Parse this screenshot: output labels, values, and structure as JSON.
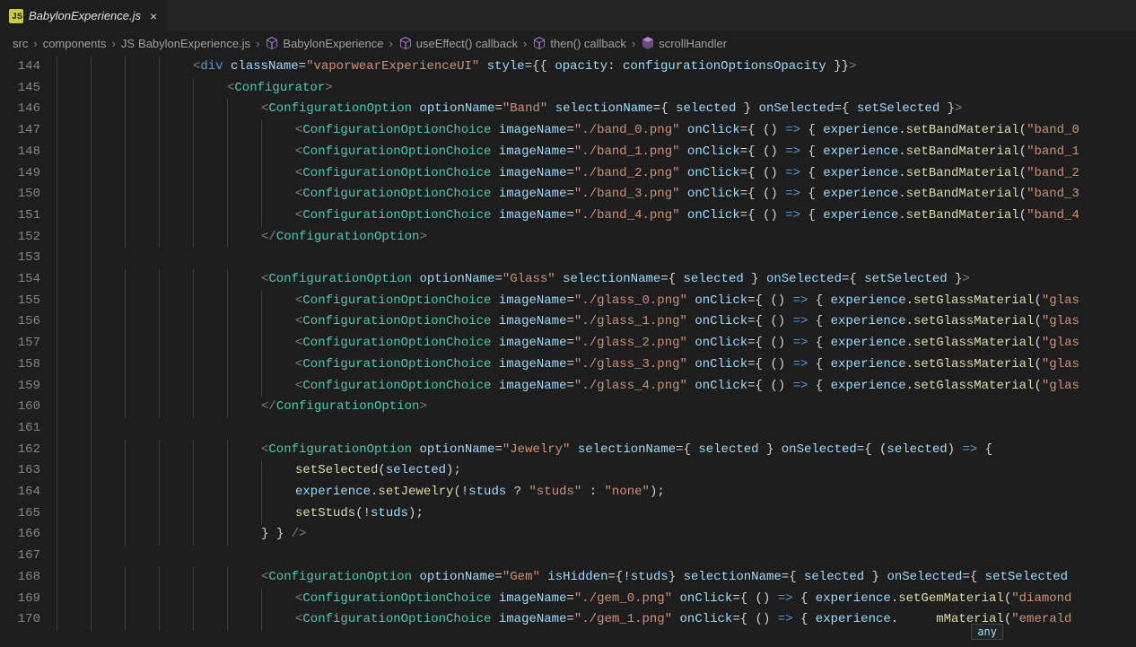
{
  "tab": {
    "filename": "BabylonExperience.js",
    "iconText": "JS"
  },
  "breadcrumb": {
    "items": [
      {
        "label": "src"
      },
      {
        "label": "components"
      },
      {
        "label": "BabylonExperience.js",
        "icon": "js"
      },
      {
        "label": "BabylonExperience",
        "icon": "cube"
      },
      {
        "label": "useEffect() callback",
        "icon": "cube"
      },
      {
        "label": "then() callback",
        "icon": "cube"
      },
      {
        "label": "scrollHandler",
        "icon": "method"
      }
    ]
  },
  "lineStart": 144,
  "lineEnd": 170,
  "hoverTip": "any",
  "lines": [
    {
      "n": 144,
      "indent": 4,
      "html": "<span class='tok-punc'>&lt;</span><span class='tok-kw'>div</span> <span class='tok-attr'>className</span><span class='tok-op'>=</span><span class='tok-str'>\"vaporwearExperienceUI\"</span> <span class='tok-attr'>style</span><span class='tok-op'>=</span><span class='tok-brace'>{{</span> <span class='tok-attr'>opacity</span><span class='tok-op'>:</span> <span class='tok-var'>configurationOptionsOpacity</span> <span class='tok-brace'>}}</span><span class='tok-punc'>&gt;</span>"
    },
    {
      "n": 145,
      "indent": 5,
      "html": "<span class='tok-punc'>&lt;</span><span class='tok-tag'>Configurator</span><span class='tok-punc'>&gt;</span>"
    },
    {
      "n": 146,
      "indent": 6,
      "html": "<span class='tok-punc'>&lt;</span><span class='tok-tag'>ConfigurationOption</span> <span class='tok-attr'>optionName</span><span class='tok-op'>=</span><span class='tok-str'>\"Band\"</span> <span class='tok-attr'>selectionName</span><span class='tok-op'>=</span><span class='tok-brace'>{</span> <span class='tok-var'>selected</span> <span class='tok-brace'>}</span> <span class='tok-attr'>onSelected</span><span class='tok-op'>=</span><span class='tok-brace'>{</span> <span class='tok-var'>setSelected</span> <span class='tok-brace'>}</span><span class='tok-punc'>&gt;</span>"
    },
    {
      "n": 147,
      "indent": 7,
      "html": "<span class='tok-punc'>&lt;</span><span class='tok-tag'>ConfigurationOptionChoice</span> <span class='tok-attr'>imageName</span><span class='tok-op'>=</span><span class='tok-str'>\"./band_0.png\"</span> <span class='tok-attr'>onClick</span><span class='tok-op'>=</span><span class='tok-brace'>{</span> <span class='tok-op'>()</span> <span class='tok-kw'>=&gt;</span> <span class='tok-brace'>{</span> <span class='tok-var'>experience</span><span class='tok-op'>.</span><span class='tok-fn'>setBandMaterial</span><span class='tok-op'>(</span><span class='tok-str'>\"band_0</span>"
    },
    {
      "n": 148,
      "indent": 7,
      "html": "<span class='tok-punc'>&lt;</span><span class='tok-tag'>ConfigurationOptionChoice</span> <span class='tok-attr'>imageName</span><span class='tok-op'>=</span><span class='tok-str'>\"./band_1.png\"</span> <span class='tok-attr'>onClick</span><span class='tok-op'>=</span><span class='tok-brace'>{</span> <span class='tok-op'>()</span> <span class='tok-kw'>=&gt;</span> <span class='tok-brace'>{</span> <span class='tok-var'>experience</span><span class='tok-op'>.</span><span class='tok-fn'>setBandMaterial</span><span class='tok-op'>(</span><span class='tok-str'>\"band_1</span>"
    },
    {
      "n": 149,
      "indent": 7,
      "html": "<span class='tok-punc'>&lt;</span><span class='tok-tag'>ConfigurationOptionChoice</span> <span class='tok-attr'>imageName</span><span class='tok-op'>=</span><span class='tok-str'>\"./band_2.png\"</span> <span class='tok-attr'>onClick</span><span class='tok-op'>=</span><span class='tok-brace'>{</span> <span class='tok-op'>()</span> <span class='tok-kw'>=&gt;</span> <span class='tok-brace'>{</span> <span class='tok-var'>experience</span><span class='tok-op'>.</span><span class='tok-fn'>setBandMaterial</span><span class='tok-op'>(</span><span class='tok-str'>\"band_2</span>"
    },
    {
      "n": 150,
      "indent": 7,
      "html": "<span class='tok-punc'>&lt;</span><span class='tok-tag'>ConfigurationOptionChoice</span> <span class='tok-attr'>imageName</span><span class='tok-op'>=</span><span class='tok-str'>\"./band_3.png\"</span> <span class='tok-attr'>onClick</span><span class='tok-op'>=</span><span class='tok-brace'>{</span> <span class='tok-op'>()</span> <span class='tok-kw'>=&gt;</span> <span class='tok-brace'>{</span> <span class='tok-var'>experience</span><span class='tok-op'>.</span><span class='tok-fn'>setBandMaterial</span><span class='tok-op'>(</span><span class='tok-str'>\"band_3</span>"
    },
    {
      "n": 151,
      "indent": 7,
      "html": "<span class='tok-punc'>&lt;</span><span class='tok-tag'>ConfigurationOptionChoice</span> <span class='tok-attr'>imageName</span><span class='tok-op'>=</span><span class='tok-str'>\"./band_4.png\"</span> <span class='tok-attr'>onClick</span><span class='tok-op'>=</span><span class='tok-brace'>{</span> <span class='tok-op'>()</span> <span class='tok-kw'>=&gt;</span> <span class='tok-brace'>{</span> <span class='tok-var'>experience</span><span class='tok-op'>.</span><span class='tok-fn'>setBandMaterial</span><span class='tok-op'>(</span><span class='tok-str'>\"band_4</span>"
    },
    {
      "n": 152,
      "indent": 6,
      "html": "<span class='tok-punc'>&lt;/</span><span class='tok-tag'>ConfigurationOption</span><span class='tok-punc'>&gt;</span>"
    },
    {
      "n": 153,
      "indent": 0,
      "html": ""
    },
    {
      "n": 154,
      "indent": 6,
      "html": "<span class='tok-punc'>&lt;</span><span class='tok-tag'>ConfigurationOption</span> <span class='tok-attr'>optionName</span><span class='tok-op'>=</span><span class='tok-str'>\"Glass\"</span> <span class='tok-attr'>selectionName</span><span class='tok-op'>=</span><span class='tok-brace'>{</span> <span class='tok-var'>selected</span> <span class='tok-brace'>}</span> <span class='tok-attr'>onSelected</span><span class='tok-op'>=</span><span class='tok-brace'>{</span> <span class='tok-var'>setSelected</span> <span class='tok-brace'>}</span><span class='tok-punc'>&gt;</span>"
    },
    {
      "n": 155,
      "indent": 7,
      "html": "<span class='tok-punc'>&lt;</span><span class='tok-tag'>ConfigurationOptionChoice</span> <span class='tok-attr'>imageName</span><span class='tok-op'>=</span><span class='tok-str'>\"./glass_0.png\"</span> <span class='tok-attr'>onClick</span><span class='tok-op'>=</span><span class='tok-brace'>{</span> <span class='tok-op'>()</span> <span class='tok-kw'>=&gt;</span> <span class='tok-brace'>{</span> <span class='tok-var'>experience</span><span class='tok-op'>.</span><span class='tok-fn'>setGlassMaterial</span><span class='tok-op'>(</span><span class='tok-str'>\"glas</span>"
    },
    {
      "n": 156,
      "indent": 7,
      "html": "<span class='tok-punc'>&lt;</span><span class='tok-tag'>ConfigurationOptionChoice</span> <span class='tok-attr'>imageName</span><span class='tok-op'>=</span><span class='tok-str'>\"./glass_1.png\"</span> <span class='tok-attr'>onClick</span><span class='tok-op'>=</span><span class='tok-brace'>{</span> <span class='tok-op'>()</span> <span class='tok-kw'>=&gt;</span> <span class='tok-brace'>{</span> <span class='tok-var'>experience</span><span class='tok-op'>.</span><span class='tok-fn'>setGlassMaterial</span><span class='tok-op'>(</span><span class='tok-str'>\"glas</span>"
    },
    {
      "n": 157,
      "indent": 7,
      "html": "<span class='tok-punc'>&lt;</span><span class='tok-tag'>ConfigurationOptionChoice</span> <span class='tok-attr'>imageName</span><span class='tok-op'>=</span><span class='tok-str'>\"./glass_2.png\"</span> <span class='tok-attr'>onClick</span><span class='tok-op'>=</span><span class='tok-brace'>{</span> <span class='tok-op'>()</span> <span class='tok-kw'>=&gt;</span> <span class='tok-brace'>{</span> <span class='tok-var'>experience</span><span class='tok-op'>.</span><span class='tok-fn'>setGlassMaterial</span><span class='tok-op'>(</span><span class='tok-str'>\"glas</span>"
    },
    {
      "n": 158,
      "indent": 7,
      "html": "<span class='tok-punc'>&lt;</span><span class='tok-tag'>ConfigurationOptionChoice</span> <span class='tok-attr'>imageName</span><span class='tok-op'>=</span><span class='tok-str'>\"./glass_3.png\"</span> <span class='tok-attr'>onClick</span><span class='tok-op'>=</span><span class='tok-brace'>{</span> <span class='tok-op'>()</span> <span class='tok-kw'>=&gt;</span> <span class='tok-brace'>{</span> <span class='tok-var'>experience</span><span class='tok-op'>.</span><span class='tok-fn'>setGlassMaterial</span><span class='tok-op'>(</span><span class='tok-str'>\"glas</span>"
    },
    {
      "n": 159,
      "indent": 7,
      "html": "<span class='tok-punc'>&lt;</span><span class='tok-tag'>ConfigurationOptionChoice</span> <span class='tok-attr'>imageName</span><span class='tok-op'>=</span><span class='tok-str'>\"./glass_4.png\"</span> <span class='tok-attr'>onClick</span><span class='tok-op'>=</span><span class='tok-brace'>{</span> <span class='tok-op'>()</span> <span class='tok-kw'>=&gt;</span> <span class='tok-brace'>{</span> <span class='tok-var'>experience</span><span class='tok-op'>.</span><span class='tok-fn'>setGlassMaterial</span><span class='tok-op'>(</span><span class='tok-str'>\"glas</span>"
    },
    {
      "n": 160,
      "indent": 6,
      "html": "<span class='tok-punc'>&lt;/</span><span class='tok-tag'>ConfigurationOption</span><span class='tok-punc'>&gt;</span>"
    },
    {
      "n": 161,
      "indent": 0,
      "html": ""
    },
    {
      "n": 162,
      "indent": 6,
      "html": "<span class='tok-punc'>&lt;</span><span class='tok-tag'>ConfigurationOption</span> <span class='tok-attr'>optionName</span><span class='tok-op'>=</span><span class='tok-str'>\"Jewelry\"</span> <span class='tok-attr'>selectionName</span><span class='tok-op'>=</span><span class='tok-brace'>{</span> <span class='tok-var'>selected</span> <span class='tok-brace'>}</span> <span class='tok-attr'>onSelected</span><span class='tok-op'>=</span><span class='tok-brace'>{</span> <span class='tok-op'>(</span><span class='tok-var'>selected</span><span class='tok-op'>)</span> <span class='tok-kw'>=&gt;</span> <span class='tok-brace'>{</span>"
    },
    {
      "n": 163,
      "indent": 7,
      "html": "<span class='tok-fn'>setSelected</span><span class='tok-op'>(</span><span class='tok-var'>selected</span><span class='tok-op'>);</span>"
    },
    {
      "n": 164,
      "indent": 7,
      "html": "<span class='tok-var'>experience</span><span class='tok-op'>.</span><span class='tok-fn'>setJewelry</span><span class='tok-op'>(!</span><span class='tok-var'>studs</span> <span class='tok-op'>?</span> <span class='tok-str'>\"studs\"</span> <span class='tok-op'>:</span> <span class='tok-str'>\"none\"</span><span class='tok-op'>);</span>"
    },
    {
      "n": 165,
      "indent": 7,
      "html": "<span class='tok-fn'>setStuds</span><span class='tok-op'>(!</span><span class='tok-var'>studs</span><span class='tok-op'>);</span>"
    },
    {
      "n": 166,
      "indent": 6,
      "html": "<span class='tok-brace'>}</span> <span class='tok-brace'>}</span> <span class='tok-punc'>/&gt;</span>"
    },
    {
      "n": 167,
      "indent": 0,
      "html": ""
    },
    {
      "n": 168,
      "indent": 6,
      "html": "<span class='tok-punc'>&lt;</span><span class='tok-tag'>ConfigurationOption</span> <span class='tok-attr'>optionName</span><span class='tok-op'>=</span><span class='tok-str'>\"Gem\"</span> <span class='tok-attr'>isHidden</span><span class='tok-op'>=</span><span class='tok-brace'>{</span><span class='tok-op'>!</span><span class='tok-var'>studs</span><span class='tok-brace'>}</span> <span class='tok-attr'>selectionName</span><span class='tok-op'>=</span><span class='tok-brace'>{</span> <span class='tok-var'>selected</span> <span class='tok-brace'>}</span> <span class='tok-attr'>onSelected</span><span class='tok-op'>=</span><span class='tok-brace'>{</span> <span class='tok-var'>setSelected</span>"
    },
    {
      "n": 169,
      "indent": 7,
      "html": "<span class='tok-punc'>&lt;</span><span class='tok-tag'>ConfigurationOptionChoice</span> <span class='tok-attr'>imageName</span><span class='tok-op'>=</span><span class='tok-str'>\"./gem_0.png\"</span> <span class='tok-attr'>onClick</span><span class='tok-op'>=</span><span class='tok-brace'>{</span> <span class='tok-op'>()</span> <span class='tok-kw'>=&gt;</span> <span class='tok-brace'>{</span> <span class='tok-var'>experience</span><span class='tok-op'>.</span><span class='tok-fn'>setGemMaterial</span><span class='tok-op'>(</span><span class='tok-str'>\"diamond</span>"
    },
    {
      "n": 170,
      "indent": 7,
      "html": "<span class='tok-punc'>&lt;</span><span class='tok-tag'>ConfigurationOptionChoice</span> <span class='tok-attr'>imageName</span><span class='tok-op'>=</span><span class='tok-str'>\"./gem_1.png\"</span> <span class='tok-attr'>onClick</span><span class='tok-op'>=</span><span class='tok-brace'>{</span> <span class='tok-op'>()</span> <span class='tok-kw'>=&gt;</span> <span class='tok-brace'>{</span> <span class='tok-var'>experience</span><span class='tok-op'>.</span><span class='tok-fn'>     mMaterial</span><span class='tok-op'>(</span><span class='tok-str'>\"emerald</span>"
    }
  ]
}
